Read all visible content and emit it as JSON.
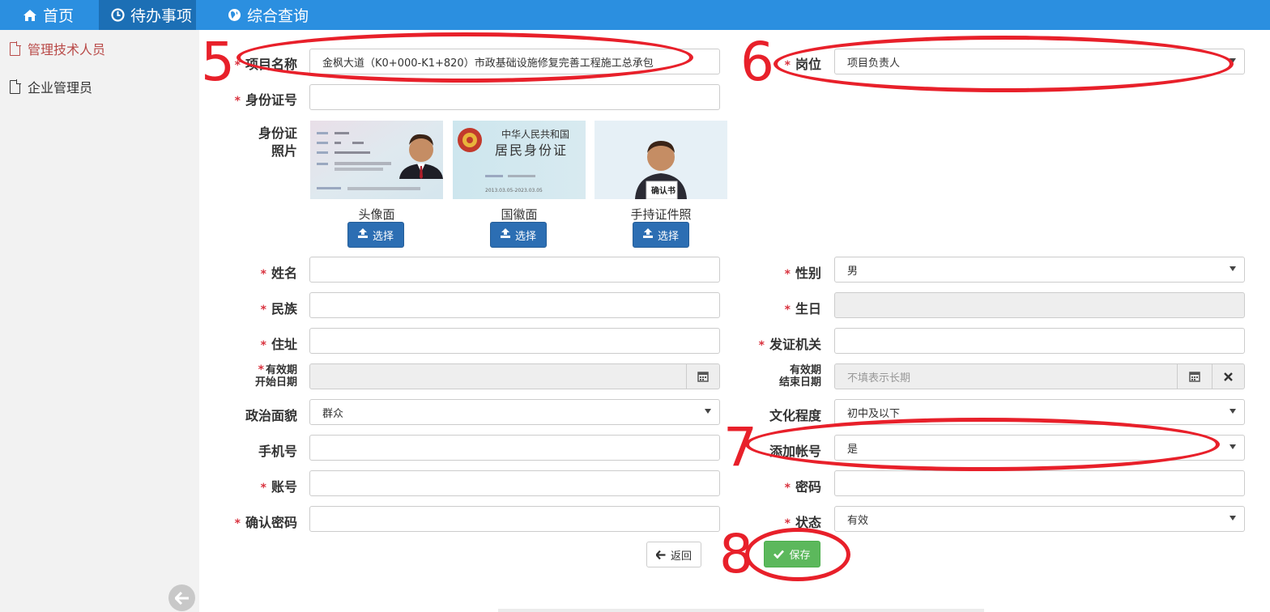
{
  "nav": {
    "home": "首页",
    "todo": "待办事项",
    "query": "综合查询"
  },
  "sidebar": {
    "items": [
      {
        "label": "管理技术人员"
      },
      {
        "label": "企业管理员"
      }
    ]
  },
  "form": {
    "project_name": {
      "label": "项目名称",
      "value": "金枫大道（K0+000-K1+820）市政基础设施修复完善工程施工总承包"
    },
    "position": {
      "label": "岗位",
      "value": "项目负责人"
    },
    "id_number": {
      "label": "身份证号",
      "value": ""
    },
    "id_photo": {
      "label_line1": "身份证",
      "label_line2": "照片"
    },
    "photos": [
      {
        "caption": "头像面",
        "button": "选择"
      },
      {
        "caption": "国徽面",
        "button": "选择"
      },
      {
        "caption": "手持证件照",
        "button": "选择"
      }
    ],
    "name": {
      "label": "姓名",
      "value": ""
    },
    "gender": {
      "label": "性别",
      "value": "男"
    },
    "ethnicity": {
      "label": "民族",
      "value": ""
    },
    "birthday": {
      "label": "生日",
      "value": ""
    },
    "address": {
      "label": "住址",
      "value": ""
    },
    "issuer": {
      "label": "发证机关",
      "value": ""
    },
    "valid_start": {
      "label_line1": "有效期",
      "label_line2": "开始日期",
      "value": ""
    },
    "valid_end": {
      "label_line1": "有效期",
      "label_line2": "结束日期",
      "placeholder": "不填表示长期"
    },
    "political": {
      "label": "政治面貌",
      "value": "群众"
    },
    "education": {
      "label": "文化程度",
      "value": "初中及以下"
    },
    "phone": {
      "label": "手机号",
      "value": ""
    },
    "add_account": {
      "label": "添加帐号",
      "value": "是"
    },
    "account": {
      "label": "账号",
      "value": ""
    },
    "password": {
      "label": "密码",
      "value": ""
    },
    "confirm_password": {
      "label": "确认密码",
      "value": ""
    },
    "status": {
      "label": "状态",
      "value": "有效"
    }
  },
  "buttons": {
    "back": "返回",
    "save": "保存"
  },
  "annotations": [
    "5",
    "6",
    "7",
    "8"
  ],
  "id_card": {
    "front_name_label": "姓名",
    "back_line1": "中华人民共和国",
    "back_line2": "居民身份证",
    "back_date": "2013.03.05-2023.03.05",
    "hold_text": "确认书"
  },
  "colors": {
    "nav_bg": "#2b8fe0",
    "primary_btn": "#2c6eb3",
    "save_btn": "#5cb85c",
    "required": "#d9333f",
    "annotation": "#e8202a"
  }
}
